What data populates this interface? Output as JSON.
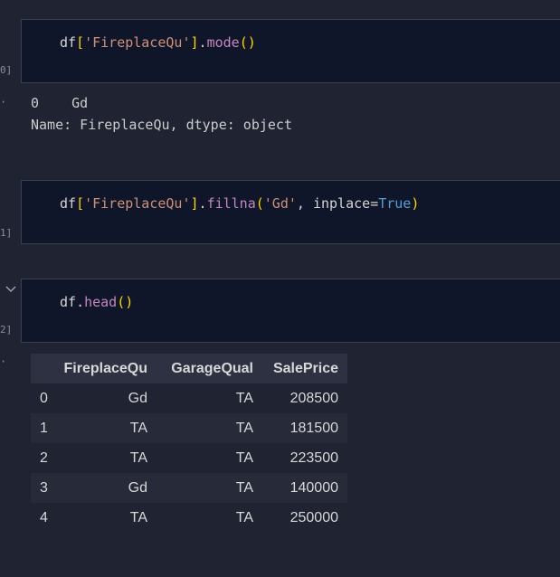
{
  "cells": [
    {
      "exec_count": "0]",
      "code": [
        {
          "t": "df",
          "c": "var"
        },
        {
          "t": "[",
          "c": "bracket"
        },
        {
          "t": "'FireplaceQu'",
          "c": "str"
        },
        {
          "t": "]",
          "c": "bracket"
        },
        {
          "t": ".",
          "c": "var"
        },
        {
          "t": "mode",
          "c": "fn"
        },
        {
          "t": "()",
          "c": "paren"
        }
      ],
      "output_marker": "·",
      "output_lines": [
        "0    Gd",
        "Name: FireplaceQu, dtype: object"
      ]
    },
    {
      "exec_count": "1]",
      "code": [
        {
          "t": "df",
          "c": "var"
        },
        {
          "t": "[",
          "c": "bracket"
        },
        {
          "t": "'FireplaceQu'",
          "c": "str"
        },
        {
          "t": "]",
          "c": "bracket"
        },
        {
          "t": ".",
          "c": "var"
        },
        {
          "t": "fillna",
          "c": "fn"
        },
        {
          "t": "(",
          "c": "paren"
        },
        {
          "t": "'Gd'",
          "c": "str"
        },
        {
          "t": ", inplace",
          "c": "var"
        },
        {
          "t": "=",
          "c": "op"
        },
        {
          "t": "True",
          "c": "kw"
        },
        {
          "t": ")",
          "c": "paren"
        }
      ]
    },
    {
      "exec_count": "2]",
      "collapse_icon": "chevron-down-icon",
      "code": [
        {
          "t": "df",
          "c": "var"
        },
        {
          "t": ".",
          "c": "var"
        },
        {
          "t": "head",
          "c": "fn"
        },
        {
          "t": "()",
          "c": "paren"
        }
      ],
      "output_marker": "·"
    }
  ],
  "dataframe": {
    "columns": [
      "",
      "FireplaceQu",
      "GarageQual",
      "SalePrice"
    ],
    "rows": [
      [
        "0",
        "Gd",
        "TA",
        "208500"
      ],
      [
        "1",
        "TA",
        "TA",
        "181500"
      ],
      [
        "2",
        "TA",
        "TA",
        "223500"
      ],
      [
        "3",
        "Gd",
        "TA",
        "140000"
      ],
      [
        "4",
        "TA",
        "TA",
        "250000"
      ]
    ]
  },
  "colors": {
    "background": "#1f2332",
    "cell_background": "#101629",
    "string": "#ce9178",
    "function": "#c586c0",
    "keyword": "#569cd6",
    "bracket": "#ffd700"
  }
}
